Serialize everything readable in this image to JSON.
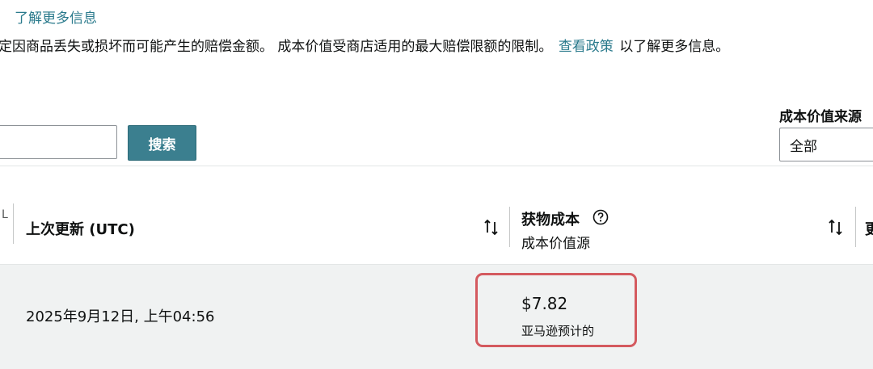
{
  "header": {
    "learn_more": "了解更多信息",
    "description_before": "定因商品丢失或损坏而可能产生的赔偿金额。 成本价值受商店适用的最大赔偿限额的限制。",
    "policy_link": "查看政策",
    "description_after": "以了解更多信息。"
  },
  "search": {
    "input_value": "",
    "button_label": "搜索"
  },
  "filter": {
    "label": "成本价值来源",
    "selected": "全部"
  },
  "table": {
    "first_col_edge": "L",
    "columns": {
      "last_updated": "上次更新 (UTC)",
      "cost_title": "获物成本",
      "cost_sub": "成本价值源",
      "next_edge": "更"
    },
    "rows": [
      {
        "last_updated": "2025年9月12日, 上午04:56",
        "cost": "$7.82",
        "cost_source": "亚马逊预计的"
      }
    ]
  },
  "colors": {
    "link": "#2a7a8c",
    "button": "#3b7f8f",
    "highlight": "#d45a5f",
    "row_bg": "#f0f2f2"
  },
  "icons": [
    "sort-icon",
    "help-icon"
  ]
}
